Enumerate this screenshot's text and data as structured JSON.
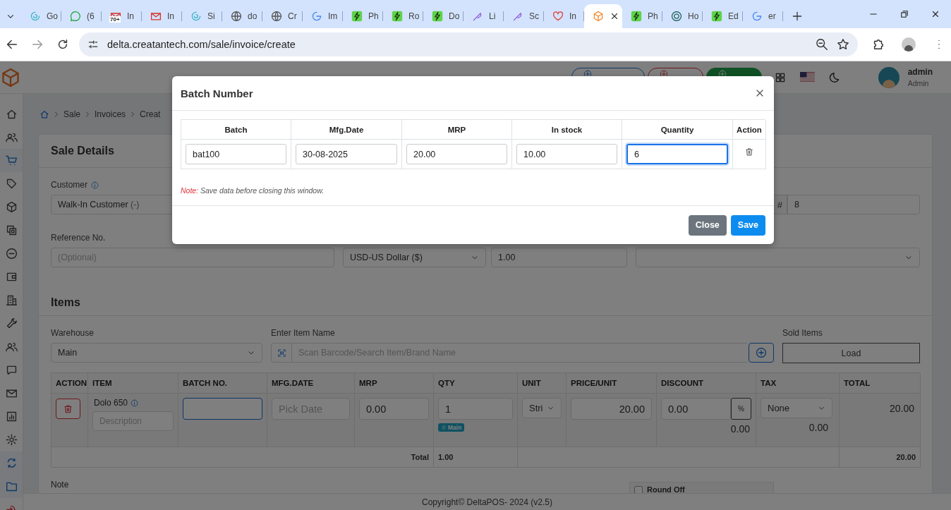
{
  "browser": {
    "tabs": [
      {
        "title": "Go",
        "selected": false
      },
      {
        "title": "(6",
        "selected": false
      },
      {
        "title": "In",
        "badge": "70+",
        "selected": false
      },
      {
        "title": "In",
        "selected": false
      },
      {
        "title": "Si",
        "selected": false
      },
      {
        "title": "do",
        "selected": false
      },
      {
        "title": "Cr",
        "selected": false
      },
      {
        "title": "Im",
        "selected": false
      },
      {
        "title": "Ph",
        "selected": false
      },
      {
        "title": "Ro",
        "selected": false
      },
      {
        "title": "Do",
        "selected": false
      },
      {
        "title": "Li",
        "selected": false
      },
      {
        "title": "Sc",
        "selected": false
      },
      {
        "title": "In",
        "selected": false
      },
      {
        "selected": true
      },
      {
        "title": "Ph",
        "selected": false
      },
      {
        "title": "Ho",
        "selected": false
      },
      {
        "title": "Ed",
        "selected": false
      },
      {
        "title": "er",
        "selected": false
      }
    ],
    "url": "delta.creatantech.com/sale/invoice/create"
  },
  "header": {
    "buttons": [
      {
        "kind": "purchase"
      },
      {
        "kind": "sale"
      },
      {
        "kind": "pos"
      }
    ],
    "user": {
      "name": "admin",
      "role": "Admin"
    }
  },
  "sidebar": {
    "items": [
      {
        "selected": false
      },
      {
        "selected": false
      },
      {
        "selected": true
      },
      {
        "selected": false
      },
      {
        "selected": false
      },
      {
        "selected": false
      },
      {
        "selected": false
      },
      {
        "selected": false
      },
      {
        "selected": false
      },
      {
        "selected": false
      },
      {
        "selected": false
      },
      {
        "selected": false
      },
      {
        "selected": false
      },
      {
        "selected": false
      },
      {
        "selected": false
      },
      {
        "selected": true
      },
      {
        "selected": true
      },
      {
        "selected": false
      }
    ]
  },
  "breadcrumb": [
    "Sale",
    "Invoices",
    "Creat"
  ],
  "sale_details": {
    "title": "Sale Details",
    "customer": {
      "label": "Customer",
      "value": "Walk-In Customer",
      "suffix": "(-)"
    },
    "invoice_number": {
      "prefix": "#",
      "value": "8"
    },
    "reference": {
      "label": "Reference No.",
      "placeholder": "(Optional)"
    },
    "currency": {
      "value": "USD-US Dollar ($)"
    },
    "exchange_rate": {
      "value": "1.00"
    }
  },
  "items": {
    "title": "Items",
    "warehouse": {
      "label": "Warehouse",
      "value": "Main"
    },
    "search": {
      "label": "Enter Item Name",
      "placeholder": "Scan Barcode/Search Item/Brand Name"
    },
    "sold_items": {
      "label": "Sold Items",
      "button": "Load"
    },
    "table": {
      "columns": [
        "ACTION",
        "ITEM",
        "BATCH NO.",
        "MFG.DATE",
        "MRP",
        "QTY",
        "UNIT",
        "PRICE/UNIT",
        "DISCOUNT",
        "TAX",
        "TOTAL"
      ],
      "rows": [
        {
          "item": "Dolo 650",
          "description_placeholder": "Description",
          "batch_highlighted": true,
          "mfg_placeholder": "Pick Date",
          "mrp": "0.00",
          "qty": "1",
          "warehouse_badge": "Main",
          "unit": "Stri",
          "price": "20.00",
          "discount": "0.00",
          "discount_type": "%",
          "discount_amount": "0.00",
          "tax": "None",
          "tax_amount": "0.00",
          "total": "20.00"
        }
      ],
      "footer": {
        "label": "Total",
        "qty": "1.00",
        "total": "20.00"
      }
    }
  },
  "note": {
    "label": "Note"
  },
  "round_off": {
    "label": "Round Off",
    "checked": false
  },
  "footer": "Copyright© DeltaPOS- 2024 (v2.5)",
  "modal": {
    "title": "Batch Number",
    "columns": [
      "Batch",
      "Mfg.Date",
      "MRP",
      "In stock",
      "Quantity",
      "Action"
    ],
    "rows": [
      {
        "batch": "bat100",
        "mfg_date": "30-08-2025",
        "mrp": "20.00",
        "in_stock": "10.00",
        "quantity": "6",
        "quantity_focused": true
      }
    ],
    "note_label": "Note:",
    "note": "Save data before closing this window.",
    "buttons": [
      {
        "kind": "secondary",
        "label": "Close"
      },
      {
        "kind": "primary",
        "label": "Save"
      }
    ]
  }
}
